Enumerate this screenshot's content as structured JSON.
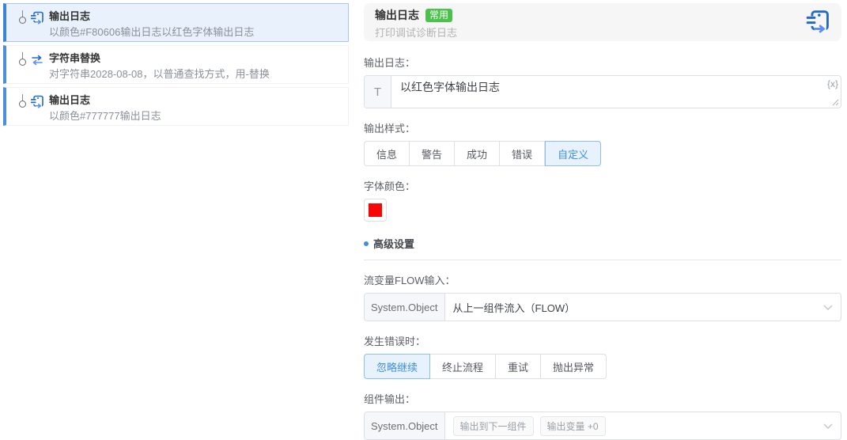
{
  "colors": {
    "accent": "#3d8fe0",
    "selected_bg": "#e9f2fc",
    "badge_green": "#4cc14c",
    "swatch_red": "#f80606"
  },
  "left_panel": {
    "items": [
      {
        "title": "输出日志",
        "subtitle": "以颜色#F80606输出日志以红色字体输出日志",
        "icon": "log-output-icon",
        "selected": true
      },
      {
        "title": "字符串替换",
        "subtitle": "对字符串2028-08-08，以普通查找方式，用-替换",
        "icon": "string-replace-icon",
        "selected": false
      },
      {
        "title": "输出日志",
        "subtitle": "以颜色#777777输出日志",
        "icon": "log-output-icon",
        "selected": false
      }
    ]
  },
  "detail_panel": {
    "header": {
      "title": "输出日志",
      "badge": "常用",
      "subtitle": "打印调试诊断日志",
      "icon": "log-output-icon"
    },
    "log_field": {
      "label": "输出日志：",
      "prefix": "T",
      "value": "以红色字体输出日志",
      "insert_variable": "{x}"
    },
    "style_group": {
      "label": "输出样式：",
      "options": [
        "信息",
        "警告",
        "成功",
        "错误",
        "自定义"
      ],
      "selected": "自定义"
    },
    "font_color": {
      "label": "字体颜色：",
      "value": "#f80606"
    },
    "advanced": {
      "label": "高级设置"
    },
    "flow_input": {
      "label": "流变量FLOW输入：",
      "type": "System.Object",
      "value": "从上一组件流入（FLOW）"
    },
    "on_error": {
      "label": "发生错误时：",
      "options": [
        "忽略继续",
        "终止流程",
        "重试",
        "抛出异常"
      ],
      "selected": "忽略继续"
    },
    "component_output": {
      "label": "组件输出：",
      "type": "System.Object",
      "chips": [
        "输出到下一组件",
        "输出变量 +0"
      ]
    }
  }
}
